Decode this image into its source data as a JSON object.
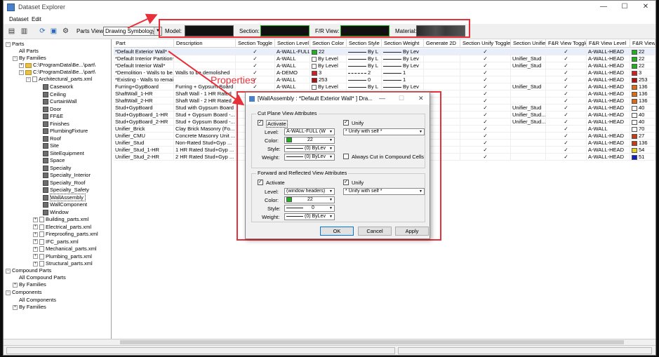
{
  "window": {
    "title": "Dataset Explorer"
  },
  "menu": {
    "items": [
      "Dataset",
      "Edit"
    ]
  },
  "toolbar": {
    "parts_view_label": "Parts View",
    "parts_view_value": "Drawing Symbology",
    "model_label": "Model:",
    "section_label": "Section:",
    "fr_view_label": "F/R View:",
    "material_label": "Material:"
  },
  "tree": {
    "parts": "Parts",
    "all_parts": "All Parts",
    "by_families": "By Families",
    "path1": "C:\\ProgramData\\Be...\\part\\",
    "path2": "C:\\ProgramData\\Be...\\part\\",
    "architectural": "Architectural_parts.xml",
    "categories": [
      "Casework",
      "Ceiling",
      "CurtainWall",
      "Door",
      "FF&E",
      "Finishes",
      "PlumbingFixture",
      "Roof",
      "Site",
      "SiteEquipment",
      "Space",
      "Specialty",
      "Specialty_Interior",
      "Specialty_Roof",
      "Specialty_Safety",
      "WallAssembly",
      "WallComponent",
      "Window"
    ],
    "files": [
      "Building_parts.xml",
      "Electrical_parts.xml",
      "Fireproofing_parts.xml",
      "IFC_parts.xml",
      "Mechanical_parts.xml",
      "Plumbing_parts.xml",
      "Structural_parts.xml"
    ],
    "compound_parts": "Compound Parts",
    "all_compound_parts": "All Compound Parts",
    "compound_by_families": "By Families",
    "components": "Components",
    "all_components": "All Components",
    "components_by_families": "By Families"
  },
  "grid": {
    "headers": [
      "Part",
      "Description",
      "Section Toggle",
      "Section Level",
      "Section Color",
      "Section Style",
      "Section Weight",
      "Generate 2D",
      "Section Unify Toggle",
      "Section Unifier",
      "F&R View Toggle",
      "F&R View Level",
      "F&R View C"
    ],
    "rows": [
      {
        "part": "*Default Exterior Wall*",
        "desc": "",
        "toggle": "✓",
        "level": "A-WALL-FULL",
        "color": "#1db31d",
        "color_num": "22",
        "style": "solid",
        "style_txt": "By L",
        "weight": "By Lev",
        "gen2d": "",
        "unify": "✓",
        "unifier": "",
        "fr_toggle": "✓",
        "fr_level": "A-WALL-HEAD",
        "fr_color": "#1db31d",
        "fr_num": "22"
      },
      {
        "part": "*Default Interior Partition*",
        "desc": "",
        "toggle": "✓",
        "level": "A-WALL",
        "color": "",
        "color_num": "By Level",
        "style": "solid",
        "style_txt": "By L",
        "weight": "By Lev",
        "gen2d": "",
        "unify": "✓",
        "unifier": "Unifier_Stud",
        "fr_toggle": "✓",
        "fr_level": "A-WALL-HEAD",
        "fr_color": "#1db31d",
        "fr_num": "22"
      },
      {
        "part": "*Default Interior Wall*",
        "desc": "",
        "toggle": "✓",
        "level": "A-WALL",
        "color": "",
        "color_num": "By Level",
        "style": "solid",
        "style_txt": "By L",
        "weight": "By Lev",
        "gen2d": "",
        "unify": "✓",
        "unifier": "Unifier_Stud",
        "fr_toggle": "✓",
        "fr_level": "A-WALL-HEAD",
        "fr_color": "#1db31d",
        "fr_num": "22"
      },
      {
        "part": "*Demolition - Walls to be...",
        "desc": "Walls to be demolished",
        "toggle": "✓",
        "level": "A-DEMO",
        "color": "#d81e1e",
        "color_num": "3",
        "style": "dash",
        "style_txt": "2",
        "weight": "1",
        "gen2d": "",
        "unify": "✓",
        "unifier": "",
        "fr_toggle": "✓",
        "fr_level": "A-WALL-HEAD",
        "fr_color": "#d81e1e",
        "fr_num": "3"
      },
      {
        "part": "*Existing - Walls to remain",
        "desc": "",
        "toggle": "✓",
        "level": "A-WALL",
        "color": "#b01010",
        "color_num": "253",
        "style": "solid",
        "style_txt": "0",
        "weight": "1",
        "gen2d": "",
        "unify": "✓",
        "unifier": "",
        "fr_toggle": "✓",
        "fr_level": "A-WALL-HEAD",
        "fr_color": "#b01010",
        "fr_num": "253"
      },
      {
        "part": "Furring+GypBoard",
        "desc": "Furring + Gypsum Board",
        "toggle": "✓",
        "level": "A-WALL",
        "color": "",
        "color_num": "By Level",
        "style": "solid",
        "style_txt": "By L",
        "weight": "By Lev",
        "gen2d": "",
        "unify": "✓",
        "unifier": "Unifier_Stud",
        "fr_toggle": "✓",
        "fr_level": "A-WALL-HEAD",
        "fr_color": "#e06a10",
        "fr_num": "136"
      },
      {
        "part": "ShaftWall_1-HR",
        "desc": "Shaft Wall - 1 HR Rated",
        "toggle": "✓",
        "level": "",
        "color": "",
        "color_num": "",
        "style": "",
        "style_txt": "",
        "weight": "",
        "gen2d": "",
        "unify": "✓",
        "unifier": "",
        "fr_toggle": "✓",
        "fr_level": "A-WALL-HEAD",
        "fr_color": "#e06a10",
        "fr_num": "136"
      },
      {
        "part": "ShaftWall_2-HR",
        "desc": "Shaft Wall - 2 HR Rated",
        "toggle": "✓",
        "level": "",
        "color": "",
        "color_num": "",
        "style": "",
        "style_txt": "",
        "weight": "",
        "gen2d": "",
        "unify": "✓",
        "unifier": "",
        "fr_toggle": "✓",
        "fr_level": "A-WALL-HEAD",
        "fr_color": "#e06a10",
        "fr_num": "136"
      },
      {
        "part": "Stud+GypBoard",
        "desc": "Stud with Gypsum Board",
        "toggle": "✓",
        "level": "",
        "color": "",
        "color_num": "",
        "style": "",
        "style_txt": "",
        "weight": "",
        "gen2d": "",
        "unify": "✓",
        "unifier": "Unifier_Stud",
        "fr_toggle": "✓",
        "fr_level": "A-WALL-HEAD",
        "fr_color": "",
        "fr_num": "40"
      },
      {
        "part": "Stud+GypBoard_1-HR",
        "desc": "Stud + Gypsum Board -...",
        "toggle": "✓",
        "level": "",
        "color": "",
        "color_num": "",
        "style": "",
        "style_txt": "",
        "weight": "",
        "gen2d": "",
        "unify": "✓",
        "unifier": "Unifier_Stud...",
        "fr_toggle": "✓",
        "fr_level": "A-WALL-HEAD",
        "fr_color": "",
        "fr_num": "40"
      },
      {
        "part": "Stud+GypBoard_2-HR",
        "desc": "Stud + Gypsum Board -...",
        "toggle": "✓",
        "level": "",
        "color": "",
        "color_num": "",
        "style": "",
        "style_txt": "",
        "weight": "",
        "gen2d": "",
        "unify": "✓",
        "unifier": "Unifier_Stud...",
        "fr_toggle": "✓",
        "fr_level": "A-WALL-HEAD",
        "fr_color": "",
        "fr_num": "40"
      },
      {
        "part": "Unifier_Brick",
        "desc": "Clay Brick Masonry (Fo...",
        "toggle": "✓",
        "level": "",
        "color": "",
        "color_num": "",
        "style": "",
        "style_txt": "",
        "weight": "",
        "gen2d": "",
        "unify": "✓",
        "unifier": "",
        "fr_toggle": "✓",
        "fr_level": "A-WALL",
        "fr_color": "",
        "fr_num": "70"
      },
      {
        "part": "Unifier_CMU",
        "desc": "Concrete Masonry Unit ...",
        "toggle": "✓",
        "level": "",
        "color": "",
        "color_num": "",
        "style": "",
        "style_txt": "",
        "weight": "",
        "gen2d": "",
        "unify": "✓",
        "unifier": "",
        "fr_toggle": "✓",
        "fr_level": "A-WALL-HEAD",
        "fr_color": "#c83c14",
        "fr_num": "27"
      },
      {
        "part": "Unifier_Stud",
        "desc": "Non-Rated Stud+Gyp ...",
        "toggle": "✓",
        "level": "",
        "color": "",
        "color_num": "",
        "style": "",
        "style_txt": "",
        "weight": "",
        "gen2d": "",
        "unify": "✓",
        "unifier": "",
        "fr_toggle": "✓",
        "fr_level": "A-WALL-HEAD",
        "fr_color": "#c83c14",
        "fr_num": "136"
      },
      {
        "part": "Unifier_Stud_1-HR",
        "desc": "1 HR Rated Stud+Gyp ...",
        "toggle": "✓",
        "level": "",
        "color": "",
        "color_num": "",
        "style": "",
        "style_txt": "",
        "weight": "",
        "gen2d": "",
        "unify": "✓",
        "unifier": "",
        "fr_toggle": "✓",
        "fr_level": "A-WALL-HEAD",
        "fr_color": "#e8d21a",
        "fr_num": "54"
      },
      {
        "part": "Unifier_Stud_2-HR",
        "desc": "2 HR Rated Stud+Gyp ...",
        "toggle": "✓",
        "level": "",
        "color": "",
        "color_num": "",
        "style": "",
        "style_txt": "",
        "weight": "",
        "gen2d": "",
        "unify": "✓",
        "unifier": "",
        "fr_toggle": "✓",
        "fr_level": "A-WALL-HEAD",
        "fr_color": "#1020c8",
        "fr_num": "51"
      }
    ]
  },
  "dialog": {
    "title": "[WallAssembly : *Default Exterior Wall* ] Dra...",
    "cut_plane_label": "Cut Plane View Attributes",
    "activate": "Activate",
    "unify": "Unify",
    "level": "Level:",
    "color": "Color:",
    "style": "Style:",
    "weight": "Weight:",
    "cut_level_value": "A-WALL-FULL (W",
    "cut_color_value": "22",
    "cut_style_value": "(0) ByLev",
    "cut_weight_value": "(0) ByLev",
    "cut_unify_value": "* Unify with self *",
    "always_cut": "Always Cut in Compound Cells",
    "forward_label": "Forward and Reflected View Attributes",
    "fr_level_value": "(window headers)",
    "fr_color_value": "22",
    "fr_style_value": "0",
    "fr_weight_value": "(0) ByLev",
    "fr_unify_value": "* Unify with self *",
    "ok": "OK",
    "cancel": "Cancel",
    "apply": "Apply"
  },
  "annotation": {
    "callout_text": "Properties",
    "accent_color": "#e8303a"
  }
}
